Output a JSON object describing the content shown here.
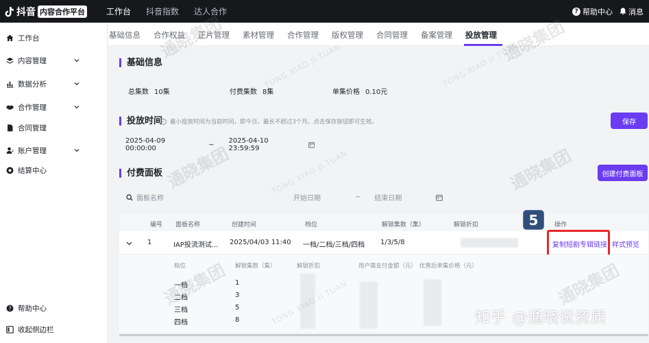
{
  "header": {
    "logo_text": "抖音",
    "logo_badge": "内容合作平台",
    "nav": [
      "工作台",
      "抖音指数",
      "达人合作"
    ],
    "help": "帮助中心",
    "message": "消息"
  },
  "sidebar": {
    "items": [
      {
        "label": "工作台"
      },
      {
        "label": "内容管理"
      },
      {
        "label": "数据分析"
      },
      {
        "label": "合作管理"
      },
      {
        "label": "合同管理"
      },
      {
        "label": "账户管理"
      },
      {
        "label": "结算中心"
      }
    ],
    "help": "帮助中心",
    "collapse": "收起侧边栏"
  },
  "tabs": [
    "基础信息",
    "合作权益",
    "正片管理",
    "素材管理",
    "合作管理",
    "版权管理",
    "合同管理",
    "备案管理",
    "投放管理"
  ],
  "basic": {
    "title": "基础信息",
    "total_label": "总集数",
    "total_value": "10集",
    "paid_label": "付费集数",
    "paid_value": "8集",
    "price_label": "单集价格",
    "price_value": "0.10元"
  },
  "schedule": {
    "title": "投放时间",
    "hint": "最小投放时间为当前时间，即今日。最长不超过3个月。点击保存按钮即可生效。",
    "save": "保存",
    "start": "2025-04-09 00:00:00",
    "sep": "~",
    "end": "2025-04-10 23:59:59"
  },
  "panel": {
    "title": "付费面板",
    "create": "创建付费面板",
    "search_placeholder": "面板名称",
    "start_date": "开始日期",
    "sep": "~",
    "end_date": "结束日期",
    "headers": [
      "编号",
      "面板名称",
      "创建时间",
      "档位",
      "解锁集数（集）",
      "解锁折扣",
      "操作"
    ],
    "row": {
      "id": "1",
      "name": "IAP投流测试...",
      "created": "2025/04/03 11:40",
      "tiers": "一档/二档/三档/四档",
      "episodes": "1/3/5/8",
      "copy_link": "复制短剧专辑链接",
      "preview": "样式预览"
    },
    "sub_headers": [
      "档位",
      "解锁集数（集）",
      "解锁折扣",
      "用户需支付金额（元）",
      "优惠后单集价格（元）"
    ],
    "sub_rows": [
      {
        "tier": "一档",
        "eps": "1"
      },
      {
        "tier": "二档",
        "eps": "3"
      },
      {
        "tier": "三档",
        "eps": "5"
      },
      {
        "tier": "四档",
        "eps": "8"
      }
    ]
  },
  "step_badge": "5",
  "watermark": {
    "cn": "通晓集团",
    "en": "TONG XIAO JI TUAN"
  },
  "zhihu": "知乎 @通晓说资质",
  "colors": {
    "accent": "#6b3cf0",
    "highlight": "#e8262a",
    "topbar": "#17181c"
  }
}
